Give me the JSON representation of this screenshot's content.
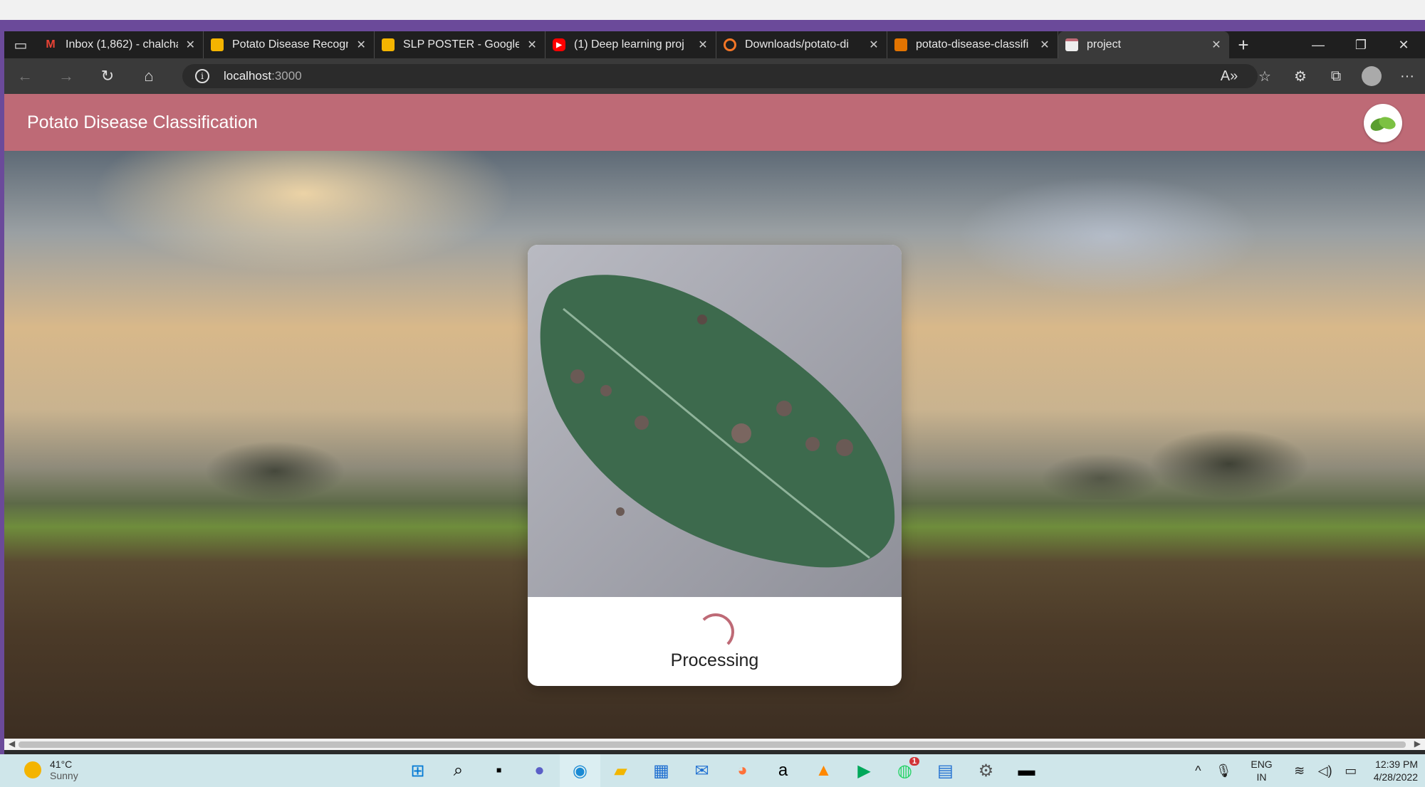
{
  "browser": {
    "tabs": [
      {
        "title": "Inbox (1,862) - chalcha",
        "favicon": "gmail-icon"
      },
      {
        "title": "Potato Disease Recogn",
        "favicon": "slides-icon"
      },
      {
        "title": "SLP POSTER - Google",
        "favicon": "slides-icon"
      },
      {
        "title": "(1) Deep learning proj",
        "favicon": "youtube-icon"
      },
      {
        "title": "Downloads/potato-di",
        "favicon": "jupyter-icon"
      },
      {
        "title": "potato-disease-classifi",
        "favicon": "notebook-icon"
      },
      {
        "title": "project",
        "favicon": "page-icon",
        "active": true
      }
    ],
    "url_host": "localhost",
    "url_port": ":3000"
  },
  "app": {
    "title": "Potato Disease Classification",
    "status": "Processing",
    "accent_color": "#be6a76"
  },
  "taskbar": {
    "temperature": "41°C",
    "condition": "Sunny",
    "whatsapp_badge": "1",
    "lang_line1": "ENG",
    "lang_line2": "IN",
    "time": "12:39 PM",
    "date": "4/28/2022"
  }
}
